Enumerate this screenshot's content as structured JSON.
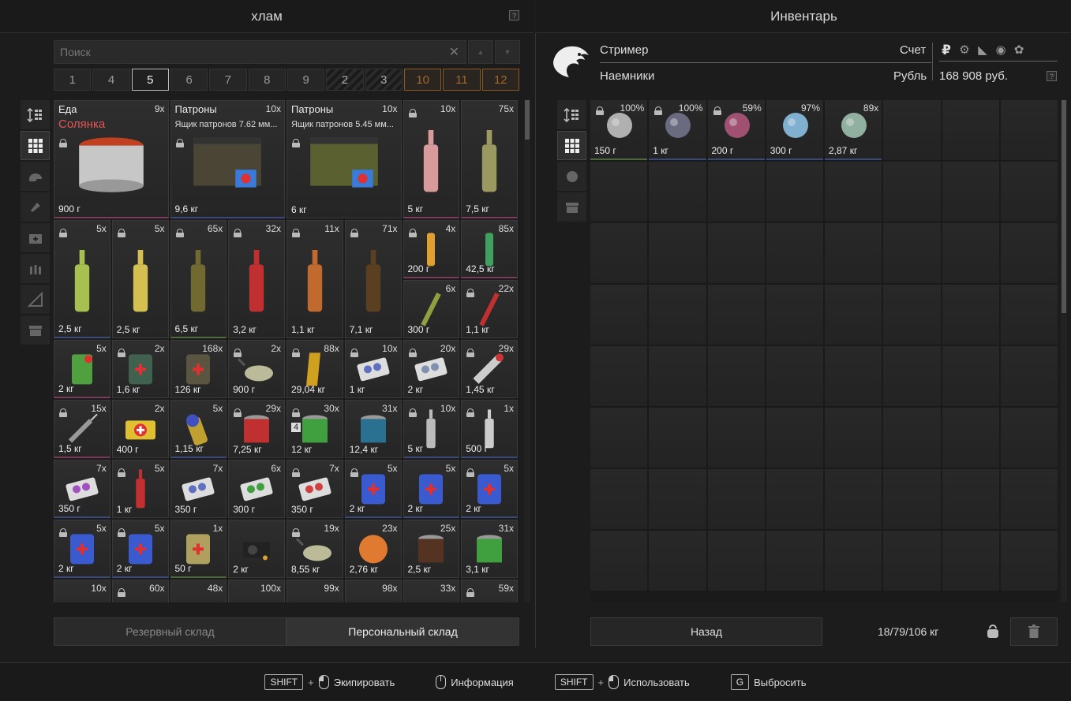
{
  "left_panel": {
    "title": "хлам",
    "help": "?",
    "search": {
      "placeholder": "Поиск",
      "clear": "✕",
      "up": "▲",
      "down": "▼"
    },
    "pages": [
      "1",
      "4",
      "5",
      "6",
      "7",
      "8",
      "9",
      "2",
      "3",
      "10",
      "11",
      "12"
    ],
    "active_page": "5",
    "bottom_tabs": [
      {
        "label": "Резервный склад"
      },
      {
        "label": "Персональный склад"
      }
    ]
  },
  "items": [
    {
      "name": "Еда",
      "sub": "Солянка",
      "count": "9x",
      "weight": "900 г"
    },
    {
      "name": "Патроны",
      "sub": "Ящик патронов 7.62 мм...",
      "count": "10x",
      "weight": "9,6 кг"
    },
    {
      "name": "Патроны",
      "sub": "Ящик патронов 5.45 мм...",
      "count": "10x",
      "weight": "6 кг"
    },
    {
      "count": "10x",
      "weight": "5 кг"
    },
    {
      "count": "75x",
      "weight": "7,5 кг"
    },
    {
      "count": "5x",
      "weight": "2,5 кг"
    },
    {
      "count": "5x",
      "weight": "2,5 кг"
    },
    {
      "count": "65x",
      "weight": "6,5 кг"
    },
    {
      "count": "32x",
      "weight": "3,2 кг"
    },
    {
      "count": "11x",
      "weight": "1,1 кг"
    },
    {
      "count": "71x",
      "weight": "7,1 кг"
    },
    {
      "count": "4x",
      "weight": "200 г"
    },
    {
      "count": "85x",
      "weight": "42,5 кг"
    },
    {
      "count": "6x",
      "weight": "300 г"
    },
    {
      "count": "22x",
      "weight": "1,1 кг"
    },
    {
      "count": "5x",
      "weight": "2 кг"
    },
    {
      "count": "2x",
      "weight": "1,6 кг"
    },
    {
      "count": "168x",
      "weight": "126 кг"
    },
    {
      "count": "2x",
      "weight": "900 г"
    },
    {
      "count": "88x",
      "weight": "29,04 кг"
    },
    {
      "count": "10x",
      "weight": "1 кг"
    },
    {
      "count": "20x",
      "weight": "2 кг"
    },
    {
      "count": "29x",
      "weight": "1,45 кг"
    },
    {
      "count": "15x",
      "weight": "1,5 кг"
    },
    {
      "count": "2x",
      "weight": "400 г"
    },
    {
      "count": "5x",
      "weight": "1,15 кг"
    },
    {
      "count": "29x",
      "weight": "7,25 кг"
    },
    {
      "count": "30x",
      "weight": "12 кг"
    },
    {
      "count": "31x",
      "weight": "12,4 кг"
    },
    {
      "count": "10x",
      "weight": "5 кг"
    },
    {
      "count": "1x",
      "weight": "500 г"
    },
    {
      "count": "7x",
      "weight": "350 г"
    },
    {
      "count": "5x",
      "weight": "1 кг"
    },
    {
      "count": "7x",
      "weight": "350 г"
    },
    {
      "count": "6x",
      "weight": "300 г"
    },
    {
      "count": "7x",
      "weight": "350 г"
    },
    {
      "count": "5x",
      "weight": "2 кг"
    },
    {
      "count": "5x",
      "weight": "2 кг"
    },
    {
      "count": "5x",
      "weight": "2 кг"
    },
    {
      "count": "5x",
      "weight": "2 кг"
    },
    {
      "count": "5x",
      "weight": "2 кг"
    },
    {
      "count": "1x",
      "weight": "50 г"
    },
    {
      "count": "",
      "weight": "2 кг"
    },
    {
      "count": "19x",
      "weight": "8,55 кг"
    },
    {
      "count": "23x",
      "weight": "2,76 кг"
    },
    {
      "count": "25x",
      "weight": "2,5 кг"
    },
    {
      "count": "31x",
      "weight": "3,1 кг"
    },
    {
      "count": "10x",
      "weight": ""
    },
    {
      "count": "60x",
      "weight": ""
    },
    {
      "count": "48x",
      "weight": ""
    },
    {
      "count": "100x",
      "weight": ""
    },
    {
      "count": "99x",
      "weight": ""
    },
    {
      "count": "98x",
      "weight": ""
    },
    {
      "count": "33x",
      "weight": ""
    },
    {
      "count": "59x",
      "weight": ""
    }
  ],
  "badge_4": "4",
  "right_panel": {
    "title": "Инвентарь",
    "player": "Стример",
    "faction": "Наемники",
    "account_label": "Счет",
    "currency_label": "Рубль",
    "money": "168 908 руб.",
    "currency_icons": [
      "ruble-icon",
      "gear-icon",
      "boot-icon",
      "compass-icon",
      "paw-icon"
    ],
    "ruble": "₽",
    "help": "?",
    "inventory": [
      {
        "pct": "100%",
        "weight": "150 г"
      },
      {
        "pct": "100%",
        "weight": "1 кг"
      },
      {
        "pct": "59%",
        "weight": "200 г"
      },
      {
        "pct": "97%",
        "weight": "300 г"
      },
      {
        "pct": "89x",
        "weight": "2,87 кг"
      }
    ],
    "back_label": "Назад",
    "weight": "18/79/106 кг"
  },
  "footer": {
    "shift": "SHIFT",
    "plus": "+",
    "equip": "Экипировать",
    "info": "Информация",
    "use": "Использовать",
    "g": "G",
    "drop": "Выбросить"
  }
}
